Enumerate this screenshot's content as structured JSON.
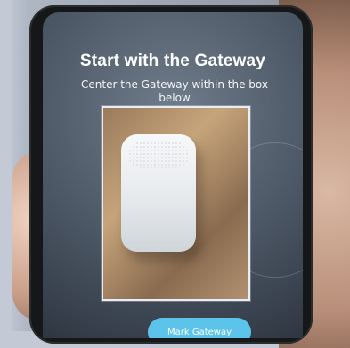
{
  "app": {
    "status": {
      "carrier": "",
      "time": "",
      "battery": ""
    },
    "title": "Start with the Gateway",
    "subtitle": "Center the Gateway within the box below",
    "primary_button": "Mark Gateway"
  },
  "colors": {
    "button_bg": "#5cc4ea",
    "title_text": "#ffffff"
  },
  "icons": {
    "camera_view": "camera-preview",
    "device": "gateway-device"
  }
}
